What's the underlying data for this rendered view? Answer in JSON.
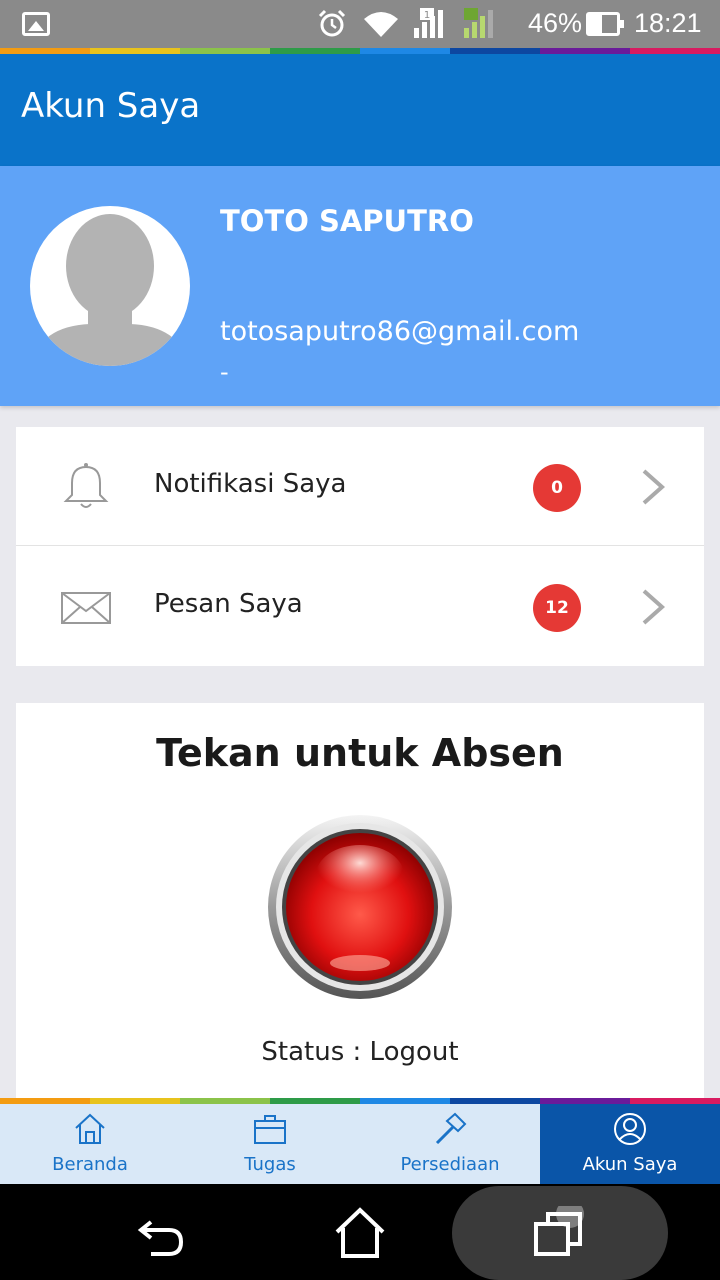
{
  "status_bar": {
    "battery_percent": "46%",
    "time": "18:21",
    "icons": [
      "gallery-icon",
      "alarm-icon",
      "wifi-icon",
      "signal-sim1-icon",
      "signal-sim2-icon",
      "battery-icon"
    ]
  },
  "app_bar": {
    "title": "Akun Saya"
  },
  "profile": {
    "name": "TOTO SAPUTRO",
    "email": "totosaputro86@gmail.com",
    "extra": "-"
  },
  "menu": {
    "items": [
      {
        "label": "Notifikasi Saya",
        "badge": "0",
        "icon": "bell-icon"
      },
      {
        "label": "Pesan Saya",
        "badge": "12",
        "icon": "envelope-icon"
      }
    ]
  },
  "absen": {
    "title": "Tekan untuk Absen",
    "status": "Status : Logout"
  },
  "bottom_nav": {
    "items": [
      {
        "label": "Beranda",
        "icon": "home-icon",
        "active": false
      },
      {
        "label": "Tugas",
        "icon": "briefcase-icon",
        "active": false
      },
      {
        "label": "Persediaan",
        "icon": "hammer-icon",
        "active": false
      },
      {
        "label": "Akun Saya",
        "icon": "user-icon",
        "active": true
      }
    ]
  },
  "colors": {
    "app_bar": "#0a73c9",
    "profile_bg": "#5fa3f7",
    "badge": "#e53935",
    "nav_bg": "#d9e8f7",
    "nav_active": "#0a55a8",
    "rainbow": [
      "#f39c12",
      "#e8c31d",
      "#8bc34a",
      "#2e9b48",
      "#1e88e5",
      "#0d47a1",
      "#6a1b9a",
      "#d81b60"
    ]
  }
}
